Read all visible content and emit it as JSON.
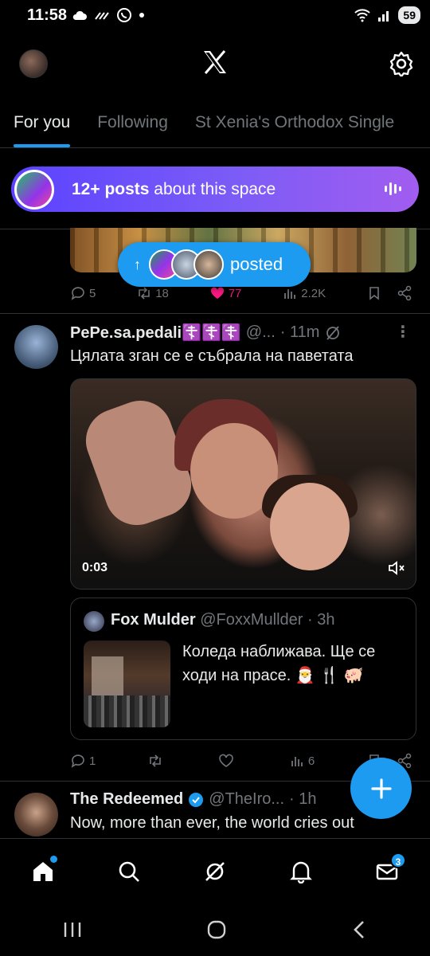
{
  "status_bar": {
    "time": "11:58",
    "battery": "59"
  },
  "tabs": [
    {
      "label": "For you",
      "active": true
    },
    {
      "label": "Following",
      "active": false
    },
    {
      "label": "St Xenia's Orthodox Single",
      "active": false
    }
  ],
  "space_banner": {
    "bold": "12+ posts",
    "rest": " about this space"
  },
  "posted_pill": {
    "label": "posted"
  },
  "tweet_prev_actions": {
    "replies": "5",
    "reposts": "18",
    "likes": "77",
    "views": "2.2K"
  },
  "tweet_1": {
    "name": "PePe.sa.pedali☦️☦️☦️",
    "handle": "@...",
    "time": "· 11m",
    "text": "Цялата зган се е събрала на паветата",
    "video_time": "0:03",
    "quote": {
      "name": "Fox Mulder",
      "handle": "@FoxxMullder",
      "time": "· 3h",
      "text": "Коледа наближава. Ще се ходи на прасе. 🎅 🍴 🐖"
    },
    "actions": {
      "replies": "1",
      "reposts": "",
      "likes": "",
      "views": "6"
    }
  },
  "tweet_2": {
    "name": "The Redeemed",
    "handle": "@TheIro...",
    "time": "· 1h",
    "text": "Now, more than ever, the world cries out"
  },
  "bottom_nav": {
    "messages_badge": "3"
  },
  "colors": {
    "accent": "#1d9bf0",
    "background": "#000000",
    "muted": "#71767b",
    "like": "#f91880"
  }
}
